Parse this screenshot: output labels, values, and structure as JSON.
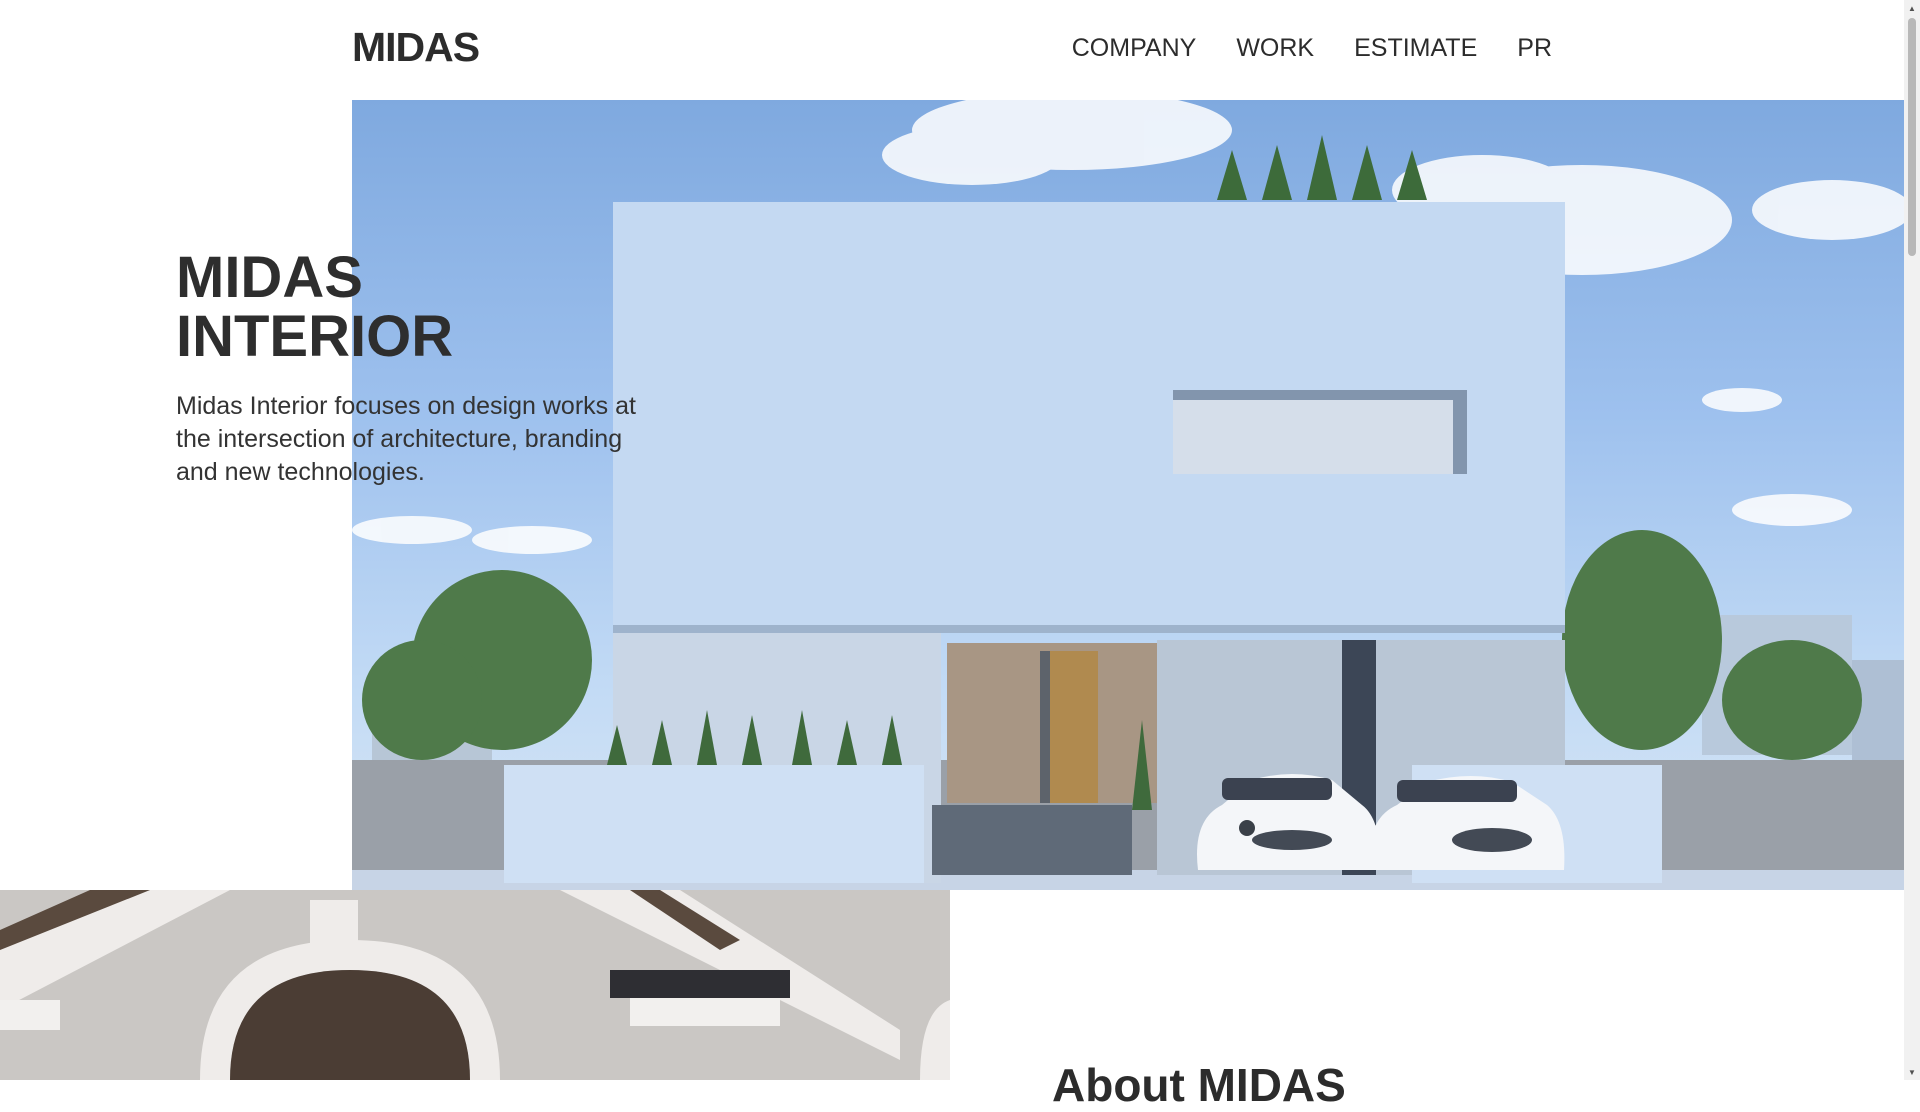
{
  "header": {
    "logo": "MIDAS",
    "nav": [
      "COMPANY",
      "WORK",
      "ESTIMATE",
      "PR"
    ]
  },
  "hero": {
    "title_line1": "MIDAS",
    "title_line2": "INTERIOR",
    "description": "Midas Interior focuses on design works at the intersection of architecture, branding and new technologies."
  },
  "about": {
    "title": "About MIDAS"
  },
  "colors": {
    "text": "#2c2c2c",
    "background": "#ffffff",
    "sky": "#8fb6e8"
  }
}
